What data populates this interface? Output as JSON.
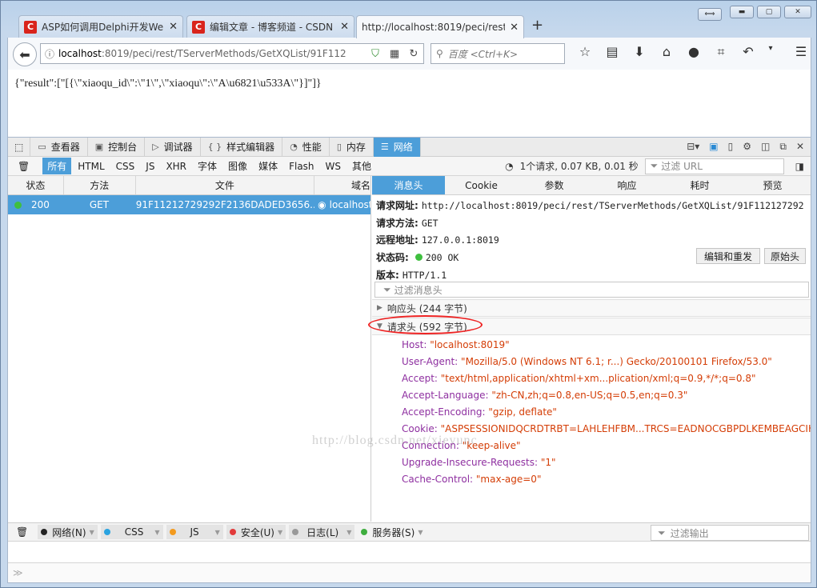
{
  "tabs": [
    {
      "label": "ASP如何调用Delphi开发We",
      "favicon": "C"
    },
    {
      "label": "编辑文章 - 博客频道 - CSDN",
      "favicon": "C"
    },
    {
      "label": "http://localhost:8019/peci/rest"
    }
  ],
  "newtab": "+",
  "address": {
    "host": "localhost",
    "rest": ":8019/peci/rest/TServerMethods/GetXQList/91F112"
  },
  "search_placeholder": "百度 <Ctrl+K>",
  "page_text": "{\"result\":[\"[{\\\"xiaoqu_id\\\":\\\"1\\\",\\\"xiaoqu\\\":\\\"A\\u6821\\u533A\\\"}]\"]}",
  "devtools": {
    "tabs": [
      "查看器",
      "控制台",
      "调试器",
      "样式编辑器",
      "性能",
      "内存",
      "网络"
    ],
    "filters": [
      "所有",
      "HTML",
      "CSS",
      "JS",
      "XHR",
      "字体",
      "图像",
      "媒体",
      "Flash",
      "WS",
      "其他"
    ],
    "summary": "1个请求, 0.07 KB, 0.01 秒",
    "url_filter": "过滤 URL",
    "columns": [
      "状态",
      "方法",
      "文件",
      "域名"
    ],
    "request": {
      "status": "200",
      "method": "GET",
      "file": "91F11212729292F2136DADED3656...",
      "domain": "localhost"
    },
    "detail_tabs": [
      "消息头",
      "Cookie",
      "参数",
      "响应",
      "耗时",
      "预览"
    ],
    "info": {
      "url_label": "请求网址:",
      "url": "http://localhost:8019/peci/rest/TServerMethods/GetXQList/91F112127292",
      "method_label": "请求方法:",
      "method": "GET",
      "remote_label": "远程地址:",
      "remote": "127.0.0.1:8019",
      "status_label": "状态码:",
      "status": "200 OK",
      "version_label": "版本:",
      "version": "HTTP/1.1"
    },
    "edit_resend": "编辑和重发",
    "raw_headers": "原始头",
    "header_filter": "过滤消息头",
    "response_headers": "响应头 (244 字节)",
    "request_headers": "请求头 (592 字节)",
    "headers": [
      {
        "k": "Host:",
        "v": "\"localhost:8019\""
      },
      {
        "k": "User-Agent:",
        "v": "\"Mozilla/5.0 (Windows NT 6.1; r...) Gecko/20100101 Firefox/53.0\""
      },
      {
        "k": "Accept:",
        "v": "\"text/html,application/xhtml+xm...plication/xml;q=0.9,*/*;q=0.8\""
      },
      {
        "k": "Accept-Language:",
        "v": "\"zh-CN,zh;q=0.8,en-US;q=0.5,en;q=0.3\""
      },
      {
        "k": "Accept-Encoding:",
        "v": "\"gzip, deflate\""
      },
      {
        "k": "Cookie:",
        "v": "\"ASPSESSIONIDQCRDTRBT=LAHLEHFBM...TRCS=EADNOCGBPDLKEMBEAGCIHLB"
      },
      {
        "k": "Connection:",
        "v": "\"keep-alive\""
      },
      {
        "k": "Upgrade-Insecure-Requests:",
        "v": "\"1\""
      },
      {
        "k": "Cache-Control:",
        "v": "\"max-age=0\""
      }
    ],
    "watermark": "http://blog.csdn.net/xieyunc",
    "console": [
      {
        "label": "网络(N)",
        "color": "#222222"
      },
      {
        "label": "CSS",
        "color": "#2aa3e0"
      },
      {
        "label": "JS",
        "color": "#f39a1e"
      },
      {
        "label": "安全(U)",
        "color": "#e23b3b"
      },
      {
        "label": "日志(L)",
        "color": "#999999"
      },
      {
        "label": "服务器(S)",
        "color": "#3fae3f"
      }
    ],
    "output_filter": "过滤输出",
    "prompt": "≫"
  }
}
